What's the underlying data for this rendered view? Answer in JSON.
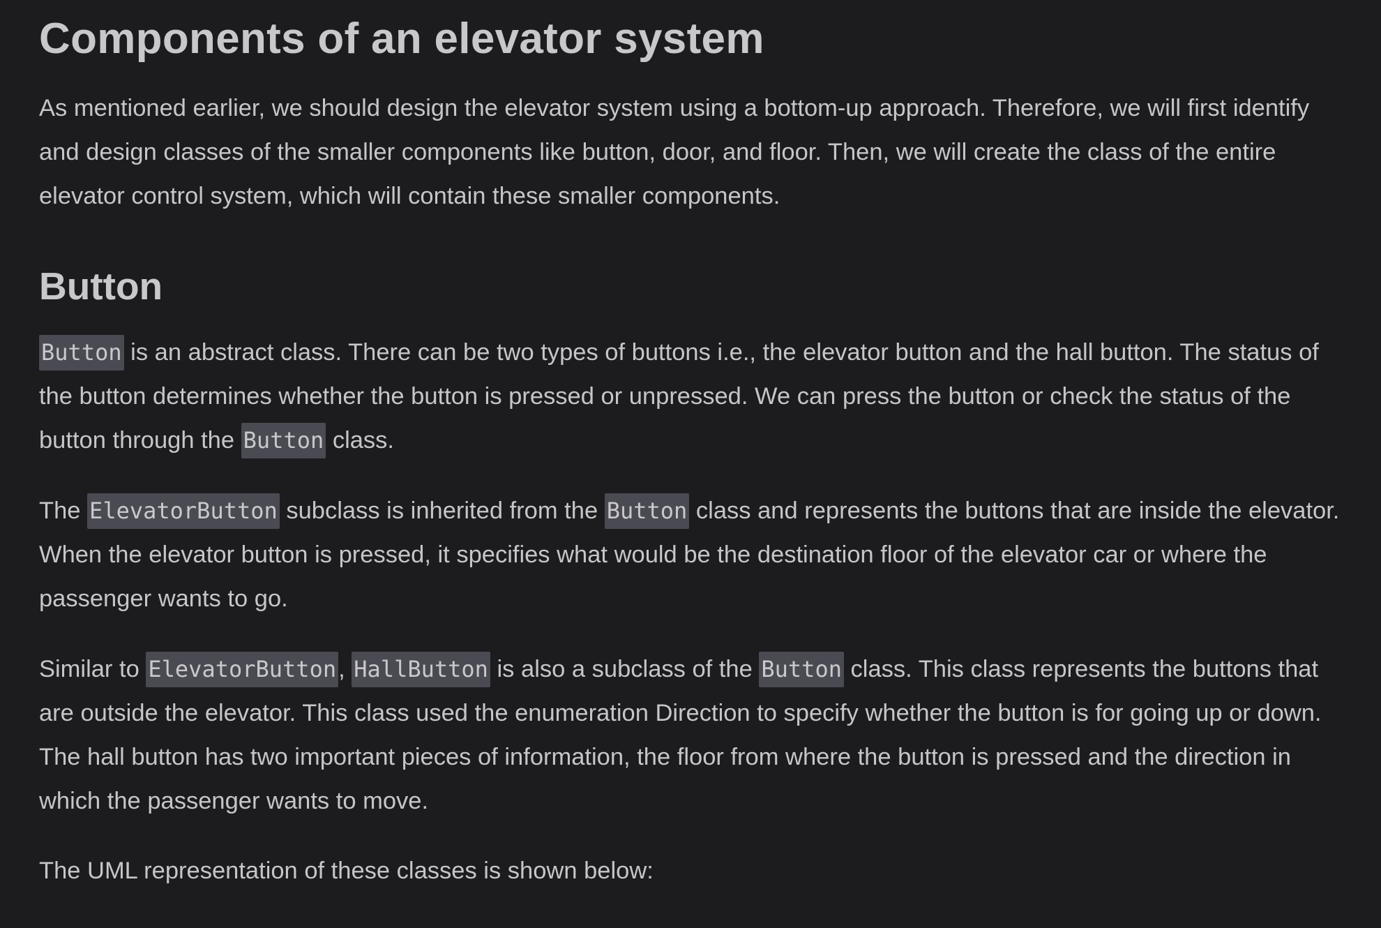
{
  "title": "Components of an elevator system",
  "intro": "As mentioned earlier, we should design the elevator system using a bottom-up approach. Therefore, we will first identify and design classes of the smaller components like button, door, and floor. Then, we will create the class of the entire elevator control system, which will contain these smaller components.",
  "button_section": {
    "heading": "Button",
    "p1": {
      "code1": "Button",
      "text1": " is an abstract class. There can be two types of buttons i.e., the elevator button and the hall button. The status of the button determines whether the button is pressed or unpressed. We can press the button or check the status of the button through the ",
      "code2": "Button",
      "text2": " class."
    },
    "p2": {
      "text1": "The ",
      "code1": "ElevatorButton",
      "text2": " subclass is inherited from the ",
      "code2": "Button",
      "text3": " class and represents the buttons that are inside the elevator. When the elevator button is pressed, it specifies what would be the destination floor of the elevator car or where the passenger wants to go."
    },
    "p3": {
      "text1": "Similar to ",
      "code1": "ElevatorButton",
      "text2": ", ",
      "code2": "HallButton",
      "text3": " is also a subclass of the ",
      "code3": "Button",
      "text4": " class. This class represents the buttons that are outside the elevator. This class used the enumeration Direction to specify whether the button is for going up or down. The hall button has two important pieces of information, the floor from where the button is pressed and the direction in which the passenger wants to move."
    },
    "p4": "The UML representation of these classes is shown below:"
  }
}
